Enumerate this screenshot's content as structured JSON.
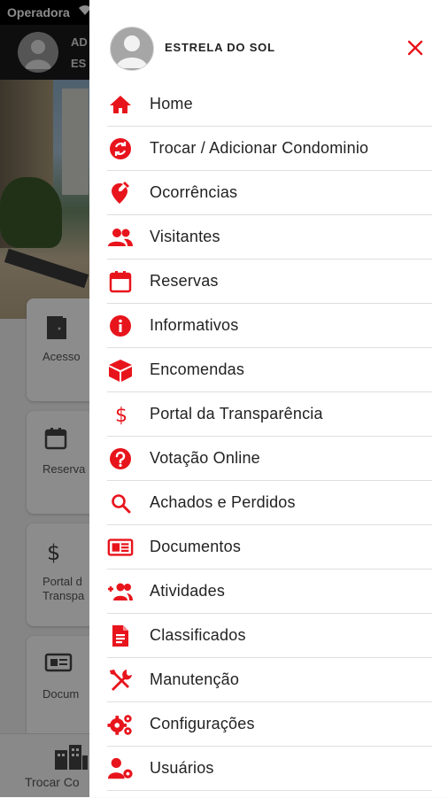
{
  "status_bar": {
    "carrier": "Operadora"
  },
  "app_header": {
    "line1": "AD",
    "line2": "ES"
  },
  "tiles": [
    {
      "label": "Acesso"
    },
    {
      "label": "Reserva"
    },
    {
      "label_line1": "Portal d",
      "label_line2": "Transpa"
    },
    {
      "label": "Docum"
    }
  ],
  "bottom_bar": {
    "label": "Trocar Co"
  },
  "drawer": {
    "user_name": "ESTRELA DO SOL",
    "accent_color": "#e8141c",
    "menu": [
      {
        "label": "Home",
        "icon": "home-icon"
      },
      {
        "label": "Trocar / Adicionar Condominio",
        "icon": "swap-icon"
      },
      {
        "label": "Ocorrências",
        "icon": "pin-edit-icon"
      },
      {
        "label": "Visitantes",
        "icon": "people-icon"
      },
      {
        "label": "Reservas",
        "icon": "calendar-icon"
      },
      {
        "label": "Informativos",
        "icon": "info-icon"
      },
      {
        "label": "Encomendas",
        "icon": "package-icon"
      },
      {
        "label": "Portal da Transparência",
        "icon": "dollar-icon"
      },
      {
        "label": "Votação Online",
        "icon": "help-icon"
      },
      {
        "label": "Achados e Perdidos",
        "icon": "search-icon"
      },
      {
        "label": "Documentos",
        "icon": "document-card-icon"
      },
      {
        "label": "Atividades",
        "icon": "add-group-icon"
      },
      {
        "label": "Classificados",
        "icon": "file-list-icon"
      },
      {
        "label": "Manutenção",
        "icon": "tools-icon"
      },
      {
        "label": "Configurações",
        "icon": "gears-icon"
      },
      {
        "label": "Usuários",
        "icon": "user-settings-icon"
      }
    ]
  }
}
